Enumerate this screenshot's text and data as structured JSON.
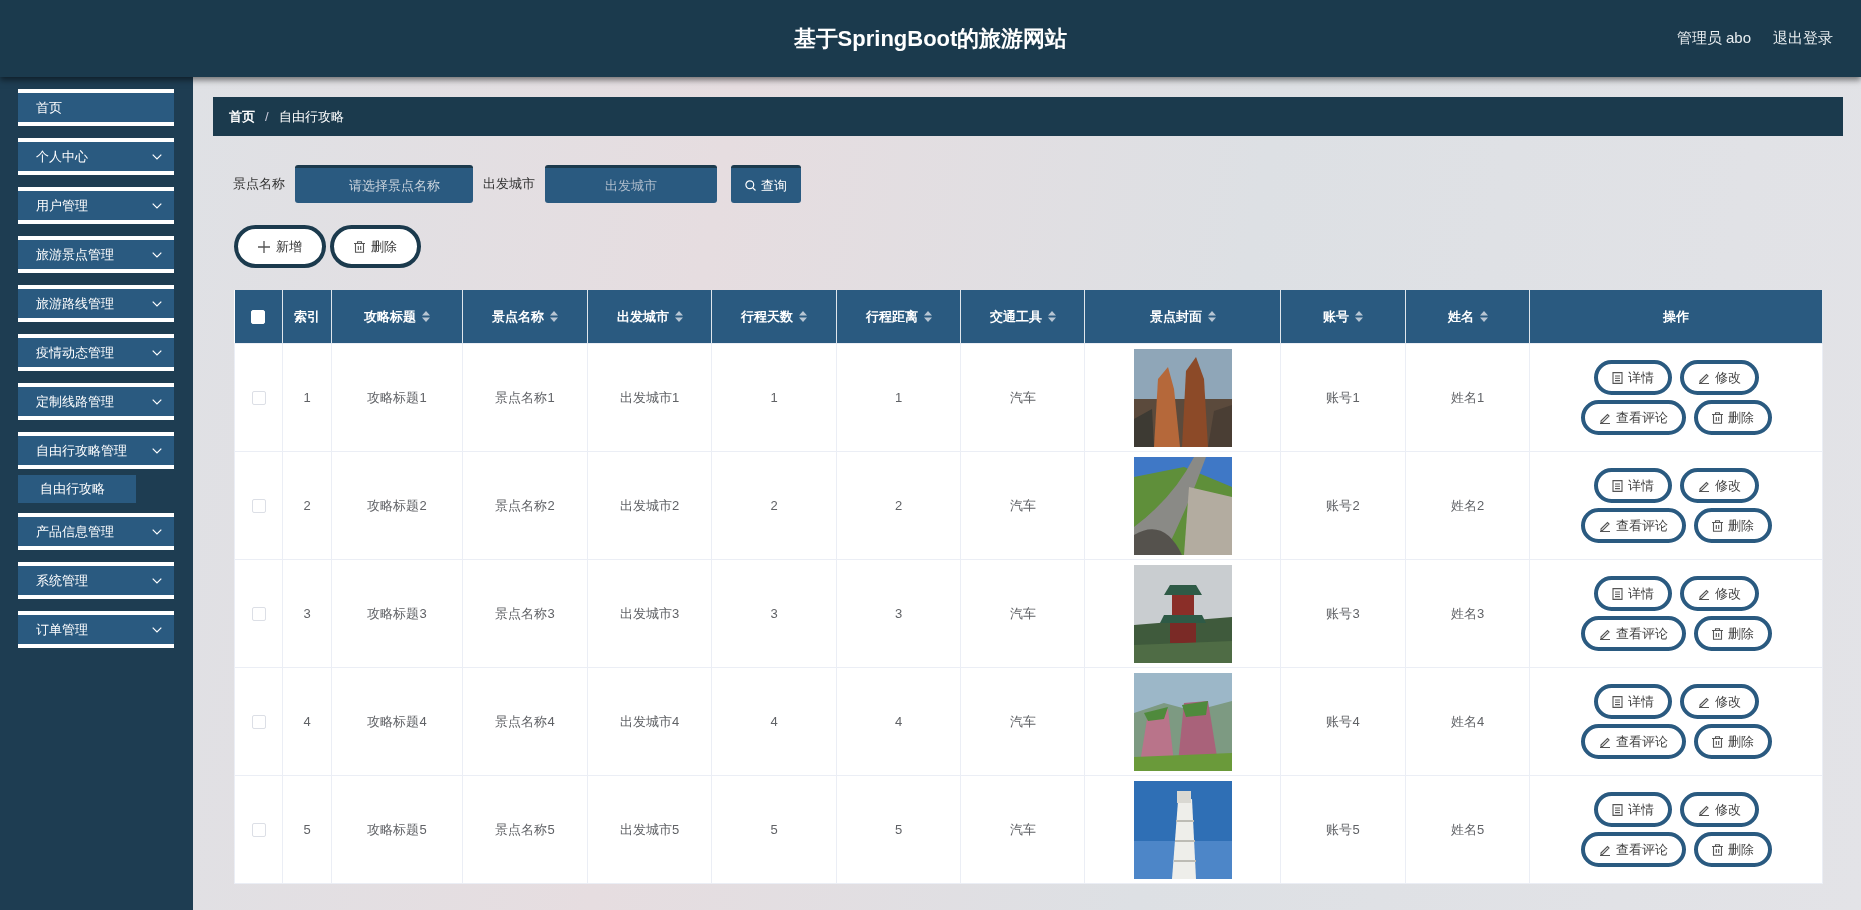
{
  "header": {
    "title": "基于SpringBoot的旅游网站",
    "user": "管理员 abo",
    "logout": "退出登录"
  },
  "sidebar": {
    "items": [
      {
        "label": "首页",
        "kind": "link",
        "selected": false
      },
      {
        "label": "个人中心",
        "kind": "submenu",
        "selected": false
      },
      {
        "label": "用户管理",
        "kind": "submenu",
        "selected": false
      },
      {
        "label": "旅游景点管理",
        "kind": "submenu",
        "selected": false
      },
      {
        "label": "旅游路线管理",
        "kind": "submenu",
        "selected": false
      },
      {
        "label": "疫情动态管理",
        "kind": "submenu",
        "selected": false
      },
      {
        "label": "定制线路管理",
        "kind": "submenu",
        "selected": false
      },
      {
        "label": "自由行攻略管理",
        "kind": "submenu",
        "selected": false,
        "children": [
          {
            "label": "自由行攻略",
            "selected": true
          }
        ]
      },
      {
        "label": "产品信息管理",
        "kind": "submenu",
        "selected": false
      },
      {
        "label": "系统管理",
        "kind": "submenu",
        "selected": false
      },
      {
        "label": "订单管理",
        "kind": "submenu",
        "selected": false
      }
    ]
  },
  "breadcrumb": {
    "items": [
      "首页",
      "自由行攻略"
    ],
    "separator": "/"
  },
  "search": {
    "fields": [
      {
        "label": "景点名称",
        "kind": "select",
        "placeholder": "请选择景点名称"
      },
      {
        "label": "出发城市",
        "kind": "input",
        "placeholder": "出发城市"
      }
    ],
    "button": "查询"
  },
  "toolbar": [
    "新增",
    "删除"
  ],
  "table": {
    "all_checked": false,
    "columns": [
      {
        "label": "索引",
        "sortable": false
      },
      {
        "label": "攻略标题",
        "sortable": true
      },
      {
        "label": "景点名称",
        "sortable": true
      },
      {
        "label": "出发城市",
        "sortable": true
      },
      {
        "label": "行程天数",
        "sortable": true
      },
      {
        "label": "行程距离",
        "sortable": true
      },
      {
        "label": "交通工具",
        "sortable": true
      },
      {
        "label": "景点封面",
        "sortable": true
      },
      {
        "label": "账号",
        "sortable": true
      },
      {
        "label": "姓名",
        "sortable": true
      },
      {
        "label": "操作",
        "sortable": false
      }
    ],
    "rows": [
      {
        "checked": false,
        "cells": [
          "1",
          "攻略标题1",
          "景点名称1",
          "出发城市1",
          "1",
          "1",
          "汽车"
        ],
        "cover": {
          "kind": "picture"
        },
        "cells2": [
          "账号1",
          "姓名1"
        ],
        "actions": [
          "详情",
          "修改",
          "查看评论",
          "删除"
        ]
      },
      {
        "checked": false,
        "cells": [
          "2",
          "攻略标题2",
          "景点名称2",
          "出发城市2",
          "2",
          "2",
          "汽车"
        ],
        "cover": {
          "kind": "picture"
        },
        "cells2": [
          "账号2",
          "姓名2"
        ],
        "actions": [
          "详情",
          "修改",
          "查看评论",
          "删除"
        ]
      },
      {
        "checked": false,
        "cells": [
          "3",
          "攻略标题3",
          "景点名称3",
          "出发城市3",
          "3",
          "3",
          "汽车"
        ],
        "cover": {
          "kind": "picture"
        },
        "cells2": [
          "账号3",
          "姓名3"
        ],
        "actions": [
          "详情",
          "修改",
          "查看评论",
          "删除"
        ]
      },
      {
        "checked": false,
        "cells": [
          "4",
          "攻略标题4",
          "景点名称4",
          "出发城市4",
          "4",
          "4",
          "汽车"
        ],
        "cover": {
          "kind": "picture"
        },
        "cells2": [
          "账号4",
          "姓名4"
        ],
        "actions": [
          "详情",
          "修改",
          "查看评论",
          "删除"
        ]
      },
      {
        "checked": false,
        "cells": [
          "5",
          "攻略标题5",
          "景点名称5",
          "出发城市5",
          "5",
          "5",
          "汽车"
        ],
        "cover": {
          "kind": "picture"
        },
        "cells2": [
          "账号5",
          "姓名5"
        ],
        "actions": [
          "详情",
          "修改",
          "查看评论",
          "删除"
        ]
      }
    ]
  }
}
